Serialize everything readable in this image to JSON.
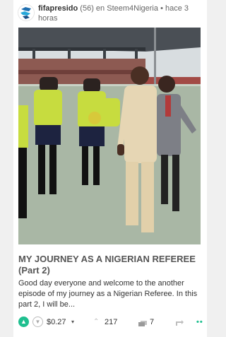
{
  "post": {
    "author": "fifapresido",
    "reputation": "(56)",
    "in_text": "en",
    "community": "Steem4Nigeria",
    "separator": "•",
    "time": "hace 3 horas",
    "title": "MY JOURNEY AS A NIGERIAN REFEREE (Part 2)",
    "excerpt": "Good day everyone and welcome to the another episode of my journey as a Nigerian Referee. In this part 2, I will be..."
  },
  "footer": {
    "upvote_icon": "chevron-up-icon",
    "downvote_icon": "chevron-down-icon",
    "payout": "$0.27",
    "payout_caret": "▾",
    "votes_icon": "chevron-up-outline-icon",
    "votes": "217",
    "comments_icon": "comments-icon",
    "comments": "7",
    "reblog_icon": "reblog-icon",
    "more_icon": "more-dots-icon"
  },
  "colors": {
    "accent": "#1fbf8f",
    "title": "#555555",
    "text": "#333333",
    "muted": "#666666"
  }
}
